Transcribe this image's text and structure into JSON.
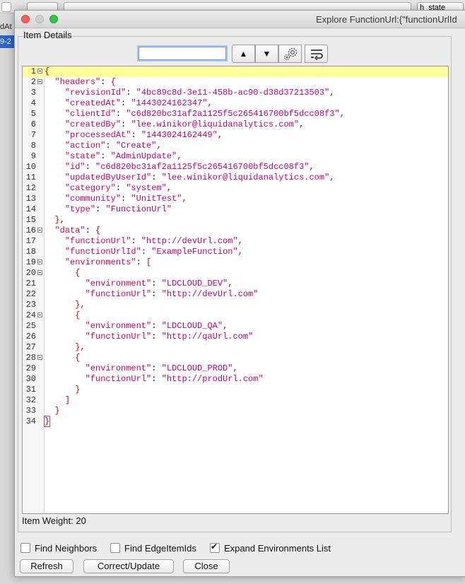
{
  "background": {
    "left_items": [
      "dAt",
      "9-2"
    ],
    "combo_right_text": "h_state"
  },
  "dialog": {
    "title": "Explore FunctionUrl:{\"functionUrlId",
    "group_label": "Item Details",
    "search": {
      "value": "",
      "placeholder": ""
    },
    "toolbar": {
      "up": "▲",
      "down": "▼"
    },
    "code_lines": [
      "{",
      "  \"headers\": {",
      "    \"revisionId\": \"4bc89c8d-3e11-458b-ac90-d38d37213503\",",
      "    \"createdAt\": \"1443024162347\",",
      "    \"clientId\": \"c6d820bc31af2a1125f5c265416700bf5dcc08f3\",",
      "    \"createdBy\": \"lee.winikor@liquidanalytics.com\",",
      "    \"processedAt\": \"1443024162449\",",
      "    \"action\": \"Create\",",
      "    \"state\": \"AdminUpdate\",",
      "    \"id\": \"c6d820bc31af2a1125f5c265416700bf5dcc08f3\",",
      "    \"updatedByUserId\": \"lee.winikor@liquidanalytics.com\",",
      "    \"category\": \"system\",",
      "    \"community\": \"UnitTest\",",
      "    \"type\": \"FunctionUrl\"",
      "  },",
      "  \"data\": {",
      "    \"functionUrl\": \"http://devUrl.com\",",
      "    \"functionUrlId\": \"ExampleFunction\",",
      "    \"environments\": [",
      "      {",
      "        \"environment\": \"LDCLOUD_DEV\",",
      "        \"functionUrl\": \"http://devUrl.com\"",
      "      },",
      "      {",
      "        \"environment\": \"LDCLOUD_QA\",",
      "        \"functionUrl\": \"http://qaUrl.com\"",
      "      },",
      "      {",
      "        \"environment\": \"LDCLOUD_PROD\",",
      "        \"functionUrl\": \"http://prodUrl.com\"",
      "      }",
      "    ]",
      "  }",
      "}"
    ],
    "fold_lines": [
      1,
      2,
      16,
      19,
      20,
      24,
      28
    ],
    "item_weight": "Item Weight: 20",
    "checkboxes": [
      {
        "label": "Find Neighbors",
        "checked": false
      },
      {
        "label": "Find EdgeItemIds",
        "checked": false
      },
      {
        "label": "Expand Environments List",
        "checked": true
      }
    ],
    "buttons": {
      "refresh": "Refresh",
      "correct_update": "Correct/Update",
      "close": "Close"
    }
  },
  "colors": {
    "key": "#d00060",
    "string": "#c0007a",
    "punct": "#d00000",
    "current_line": "#ffff99",
    "selection": "#2a63c9"
  }
}
